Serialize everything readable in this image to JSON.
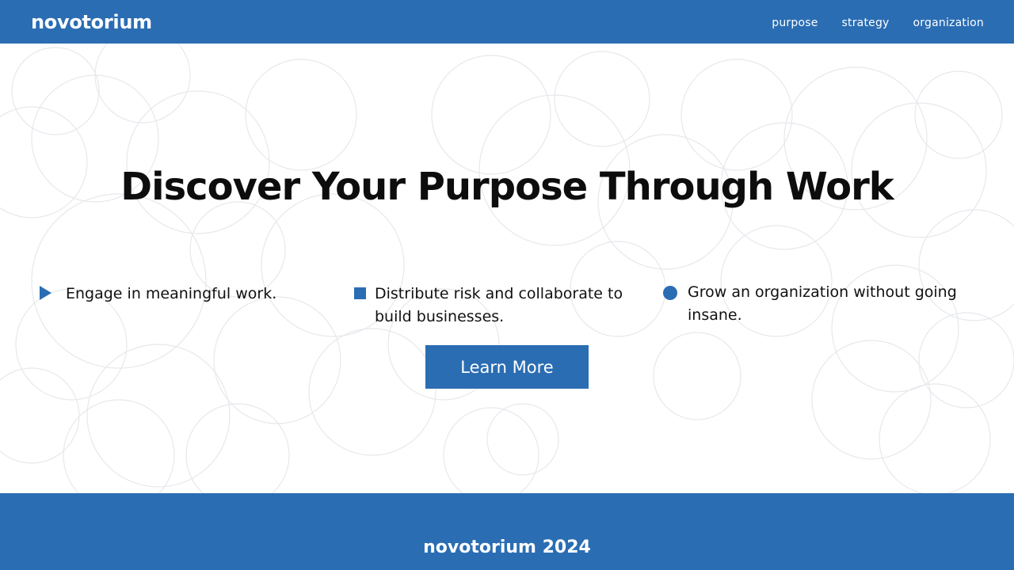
{
  "header": {
    "brand": "novotorium",
    "nav": [
      "purpose",
      "strategy",
      "organization"
    ]
  },
  "hero": {
    "headline": "Discover Your Purpose Through Work",
    "features": [
      {
        "icon": "triangle-icon",
        "text": "Engage in meaningful work."
      },
      {
        "icon": "square-icon",
        "text": "Distribute risk and collaborate to build businesses."
      },
      {
        "icon": "circle-icon",
        "text": "Grow an organization without going insane."
      }
    ],
    "cta_label": "Learn More"
  },
  "footer": {
    "text": "novotorium 2024"
  },
  "colors": {
    "accent": "#2a6db3",
    "background": "#ffffff",
    "text": "#111111"
  }
}
